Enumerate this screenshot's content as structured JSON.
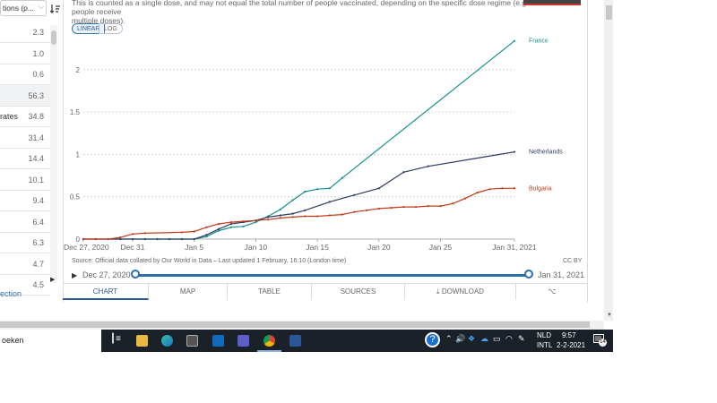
{
  "left_panel": {
    "header": "tions (p...",
    "rows": [
      {
        "label": "",
        "value": "2.3"
      },
      {
        "label": "",
        "value": "1.0"
      },
      {
        "label": "",
        "value": "0.6"
      },
      {
        "label": "",
        "value": "56.3"
      },
      {
        "label": "rates",
        "value": "34.8"
      },
      {
        "label": "",
        "value": "31.4"
      },
      {
        "label": "",
        "value": "14.4"
      },
      {
        "label": "",
        "value": "10.1"
      },
      {
        "label": "",
        "value": "9.4"
      },
      {
        "label": "",
        "value": "6.4"
      },
      {
        "label": "",
        "value": "6.3"
      },
      {
        "label": "",
        "value": "4.7"
      },
      {
        "label": "",
        "value": "4.5"
      }
    ],
    "link": "ection"
  },
  "chart_header": {
    "subtitle_line1": "This is counted as a single dose, and may not equal the total number of people vaccinated, depending on the specific dose regime (e.g. people receive",
    "subtitle_line2": "multiple doses).",
    "linear_label": "LINEAR",
    "log_label": "LOG"
  },
  "chart_data": {
    "type": "line",
    "x_ticks": [
      {
        "label": "Dec 27, 2020",
        "day": 0
      },
      {
        "label": "Dec 31",
        "day": 4
      },
      {
        "label": "Jan 5",
        "day": 9
      },
      {
        "label": "Jan 10",
        "day": 14
      },
      {
        "label": "Jan 15",
        "day": 19
      },
      {
        "label": "Jan 20",
        "day": 24
      },
      {
        "label": "Jan 25",
        "day": 29
      },
      {
        "label": "Jan 31, 2021",
        "day": 35
      }
    ],
    "y_ticks": [
      0,
      0.5,
      1,
      1.5,
      2
    ],
    "ylim": [
      0,
      2.4
    ],
    "grid": "horizontal-dotted",
    "series": [
      {
        "name": "France",
        "color": "#16908e",
        "points": [
          [
            0,
            0
          ],
          [
            1,
            0
          ],
          [
            2,
            0
          ],
          [
            3,
            0
          ],
          [
            4,
            0
          ],
          [
            5,
            0
          ],
          [
            6,
            0
          ],
          [
            7,
            0
          ],
          [
            8,
            0
          ],
          [
            9,
            0
          ],
          [
            10,
            0.03
          ],
          [
            11,
            0.1
          ],
          [
            12,
            0.14
          ],
          [
            13,
            0.15
          ],
          [
            14,
            0.2
          ],
          [
            15,
            0.27
          ],
          [
            16,
            0.35
          ],
          [
            17,
            0.46
          ],
          [
            18,
            0.56
          ],
          [
            19,
            0.59
          ],
          [
            20,
            0.6
          ],
          [
            21,
            0.72
          ],
          [
            35,
            2.34
          ]
        ]
      },
      {
        "name": "Netherlands",
        "color": "#2c3e63",
        "points": [
          [
            0,
            0
          ],
          [
            1,
            0
          ],
          [
            2,
            0
          ],
          [
            3,
            0
          ],
          [
            4,
            0
          ],
          [
            5,
            0
          ],
          [
            6,
            0
          ],
          [
            7,
            0
          ],
          [
            8,
            0
          ],
          [
            9,
            0
          ],
          [
            10,
            0.05
          ],
          [
            11,
            0.12
          ],
          [
            12,
            0.18
          ],
          [
            13,
            0.2
          ],
          [
            14,
            0.22
          ],
          [
            15,
            0.26
          ],
          [
            16,
            0.28
          ],
          [
            17,
            0.3
          ],
          [
            18,
            0.34
          ],
          [
            20,
            0.44
          ],
          [
            22,
            0.52
          ],
          [
            24,
            0.6
          ],
          [
            26,
            0.79
          ],
          [
            28,
            0.86
          ],
          [
            35,
            1.03
          ]
        ]
      },
      {
        "name": "Bulgaria",
        "color": "#c43b1a",
        "points": [
          [
            0,
            0
          ],
          [
            1,
            0
          ],
          [
            2,
            0
          ],
          [
            3,
            0.02
          ],
          [
            4,
            0.06
          ],
          [
            5,
            0.07
          ],
          [
            8,
            0.08
          ],
          [
            9,
            0.09
          ],
          [
            10,
            0.14
          ],
          [
            11,
            0.18
          ],
          [
            12,
            0.2
          ],
          [
            13,
            0.21
          ],
          [
            14,
            0.22
          ],
          [
            15,
            0.23
          ],
          [
            16,
            0.25
          ],
          [
            17,
            0.26
          ],
          [
            18,
            0.27
          ],
          [
            19,
            0.27
          ],
          [
            20,
            0.28
          ],
          [
            21,
            0.29
          ],
          [
            22,
            0.32
          ],
          [
            23,
            0.34
          ],
          [
            24,
            0.36
          ],
          [
            25,
            0.37
          ],
          [
            26,
            0.38
          ],
          [
            27,
            0.38
          ],
          [
            28,
            0.39
          ],
          [
            29,
            0.39
          ],
          [
            30,
            0.42
          ],
          [
            31,
            0.48
          ],
          [
            32,
            0.55
          ],
          [
            33,
            0.59
          ],
          [
            34,
            0.6
          ],
          [
            35,
            0.6
          ]
        ]
      }
    ]
  },
  "footer": {
    "source": "Source: Official data collated by Our World in Data – Last updated 1 February, 16:10 (London time)",
    "license": "CC BY",
    "timeline_start": "Dec 27, 2020",
    "timeline_end": "Jan 31, 2021"
  },
  "tabs": [
    "CHART",
    "MAP",
    "TABLE",
    "SOURCES",
    "DOWNLOAD",
    ""
  ],
  "taskbar": {
    "search_text": "oeken",
    "lang_1": "NLD",
    "lang_2": "INTL",
    "time": "9:57",
    "date": "2-2-2021",
    "notif_count": "14"
  }
}
